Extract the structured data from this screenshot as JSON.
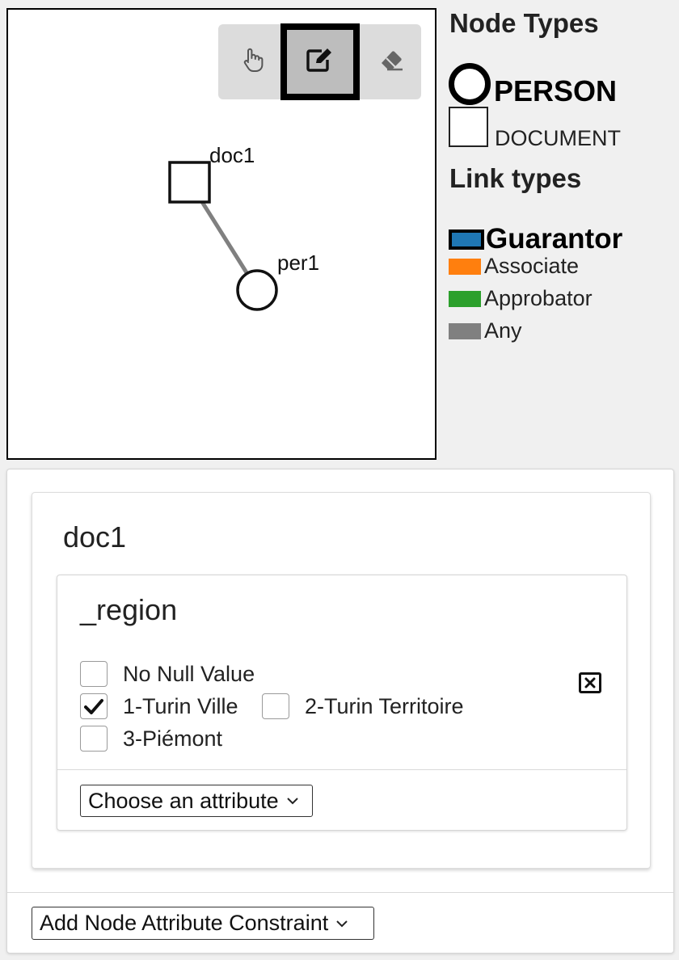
{
  "toolbar": {
    "tools": [
      {
        "icon": "hand-pointer-icon",
        "selected": false
      },
      {
        "icon": "edit-icon",
        "selected": true
      },
      {
        "icon": "eraser-icon",
        "selected": false
      }
    ]
  },
  "graph": {
    "nodes": [
      {
        "id": "doc1",
        "label": "doc1",
        "type": "DOCUMENT"
      },
      {
        "id": "per1",
        "label": "per1",
        "type": "PERSON"
      }
    ],
    "edge_color": "#808080"
  },
  "legend": {
    "node_types_title": "Node Types",
    "node_types": [
      {
        "label": "PERSON",
        "shape": "circle",
        "selected": true
      },
      {
        "label": "DOCUMENT",
        "shape": "square",
        "selected": false
      }
    ],
    "link_types_title": "Link types",
    "link_types": [
      {
        "label": "Guarantor",
        "color": "#1f77b4",
        "selected": true
      },
      {
        "label": "Associate",
        "color": "#ff7f0e",
        "selected": false
      },
      {
        "label": "Approbator",
        "color": "#2ca02c",
        "selected": false
      },
      {
        "label": "Any",
        "color": "#808080",
        "selected": false
      }
    ]
  },
  "constraints": {
    "node_title": "doc1",
    "attribute": {
      "name": "_region",
      "options": [
        {
          "label": "No Null Value",
          "checked": false
        },
        {
          "label": "1-Turin Ville",
          "checked": true
        },
        {
          "label": "2-Turin Territoire",
          "checked": false
        },
        {
          "label": "3-Piémont",
          "checked": false
        }
      ]
    },
    "choose_attribute": "Choose an attribute",
    "add_constraint": "Add Node Attribute Constraint"
  }
}
